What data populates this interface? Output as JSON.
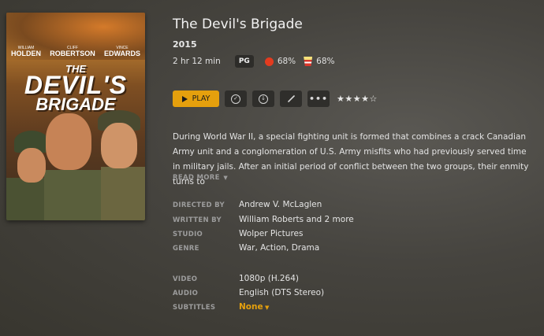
{
  "movie": {
    "title": "The Devil's Brigade",
    "year": "2015",
    "duration": "2 hr 12 min",
    "content_rating": "PG",
    "critic_score": "68%",
    "audience_score": "68%",
    "user_rating_stars": "★★★★☆",
    "user_rating_value": 4,
    "summary": "During World War II, a special fighting unit is formed that combines a crack Canadian Army unit and a conglomeration of U.S. Army misfits who had previously served time in military jails. After an initial period of conflict between the two groups, their enmity turns to",
    "read_more_label": "READ MORE"
  },
  "poster": {
    "cast": [
      {
        "first": "WILLIAM",
        "last": "HOLDEN"
      },
      {
        "first": "CLIFF",
        "last": "ROBERTSON"
      },
      {
        "first": "VINCE",
        "last": "EDWARDS"
      }
    ],
    "title_line1": "THE",
    "title_line2": "DEVIL'S",
    "title_line3": "BRIGADE"
  },
  "actions": {
    "play_label": "PLAY",
    "watched_icon": "check-circle-icon",
    "download_icon": "download-icon",
    "edit_icon": "pencil-icon",
    "more_icon": "more-icon"
  },
  "details": {
    "directed_by_label": "DIRECTED BY",
    "directed_by": "Andrew V. McLaglen",
    "written_by_label": "WRITTEN BY",
    "written_by": "William Roberts  and 2 more",
    "studio_label": "STUDIO",
    "studio": "Wolper Pictures",
    "genre_label": "GENRE",
    "genre": "War, Action, Drama",
    "video_label": "VIDEO",
    "video": "1080p (H.264)",
    "audio_label": "AUDIO",
    "audio": "English (DTS Stereo)",
    "subtitles_label": "SUBTITLES",
    "subtitles": "None"
  },
  "colors": {
    "accent": "#e5a00d",
    "background": "#46443f",
    "button_bg": "#2f2e2b",
    "label": "#9c9c9c"
  }
}
